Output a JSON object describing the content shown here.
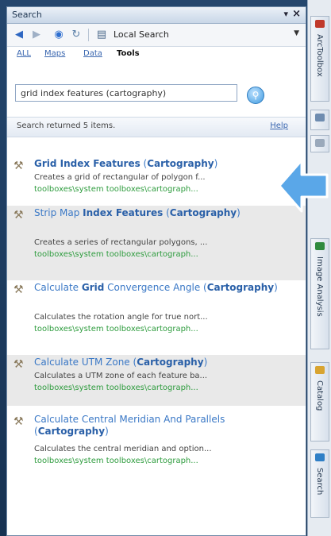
{
  "pane": {
    "title": "Search"
  },
  "toolbar": {
    "scope_label": "Local Search"
  },
  "filters": {
    "all": "ALL",
    "maps": "Maps",
    "data": "Data",
    "tools": "Tools"
  },
  "search": {
    "query": "grid index features (cartography)"
  },
  "status": {
    "text": "Search returned 5 items.",
    "help": "Help"
  },
  "results": [
    {
      "title_parts": [
        "Grid Index Features",
        " (",
        "Cartography",
        ")"
      ],
      "desc": "Creates a grid of rectangular of polygon f...",
      "path": "toolboxes\\system toolboxes\\cartograph..."
    },
    {
      "title_parts": [
        "Strip Map ",
        "Index Features",
        " (",
        "Cartography",
        ")"
      ],
      "desc": "Creates a series of rectangular polygons, ...",
      "path": "toolboxes\\system toolboxes\\cartograph..."
    },
    {
      "title_parts": [
        "Calculate ",
        "Grid",
        " Convergence Angle (",
        "Cartography",
        ")"
      ],
      "desc": "Calculates the rotation angle for true nort...",
      "path": "toolboxes\\system toolboxes\\cartograph..."
    },
    {
      "title_parts": [
        "Calculate UTM Zone (",
        "Cartography",
        ")"
      ],
      "desc": "Calculates a UTM zone of each feature ba...",
      "path": "toolboxes\\system toolboxes\\cartograph..."
    },
    {
      "title_parts": [
        "Calculate Central Meridian And Parallels (",
        "Cartography",
        ")"
      ],
      "desc": "Calculates the central meridian and option...",
      "path": "toolboxes\\system toolboxes\\cartograph..."
    }
  ],
  "dock_tabs": [
    "ArcToolbox",
    "Image Analysis",
    "Catalog",
    "Search"
  ],
  "colors": {
    "accent_arrow": "#5aa7e8",
    "link_blue": "#3a78c6",
    "path_green": "#2e9c3e"
  }
}
